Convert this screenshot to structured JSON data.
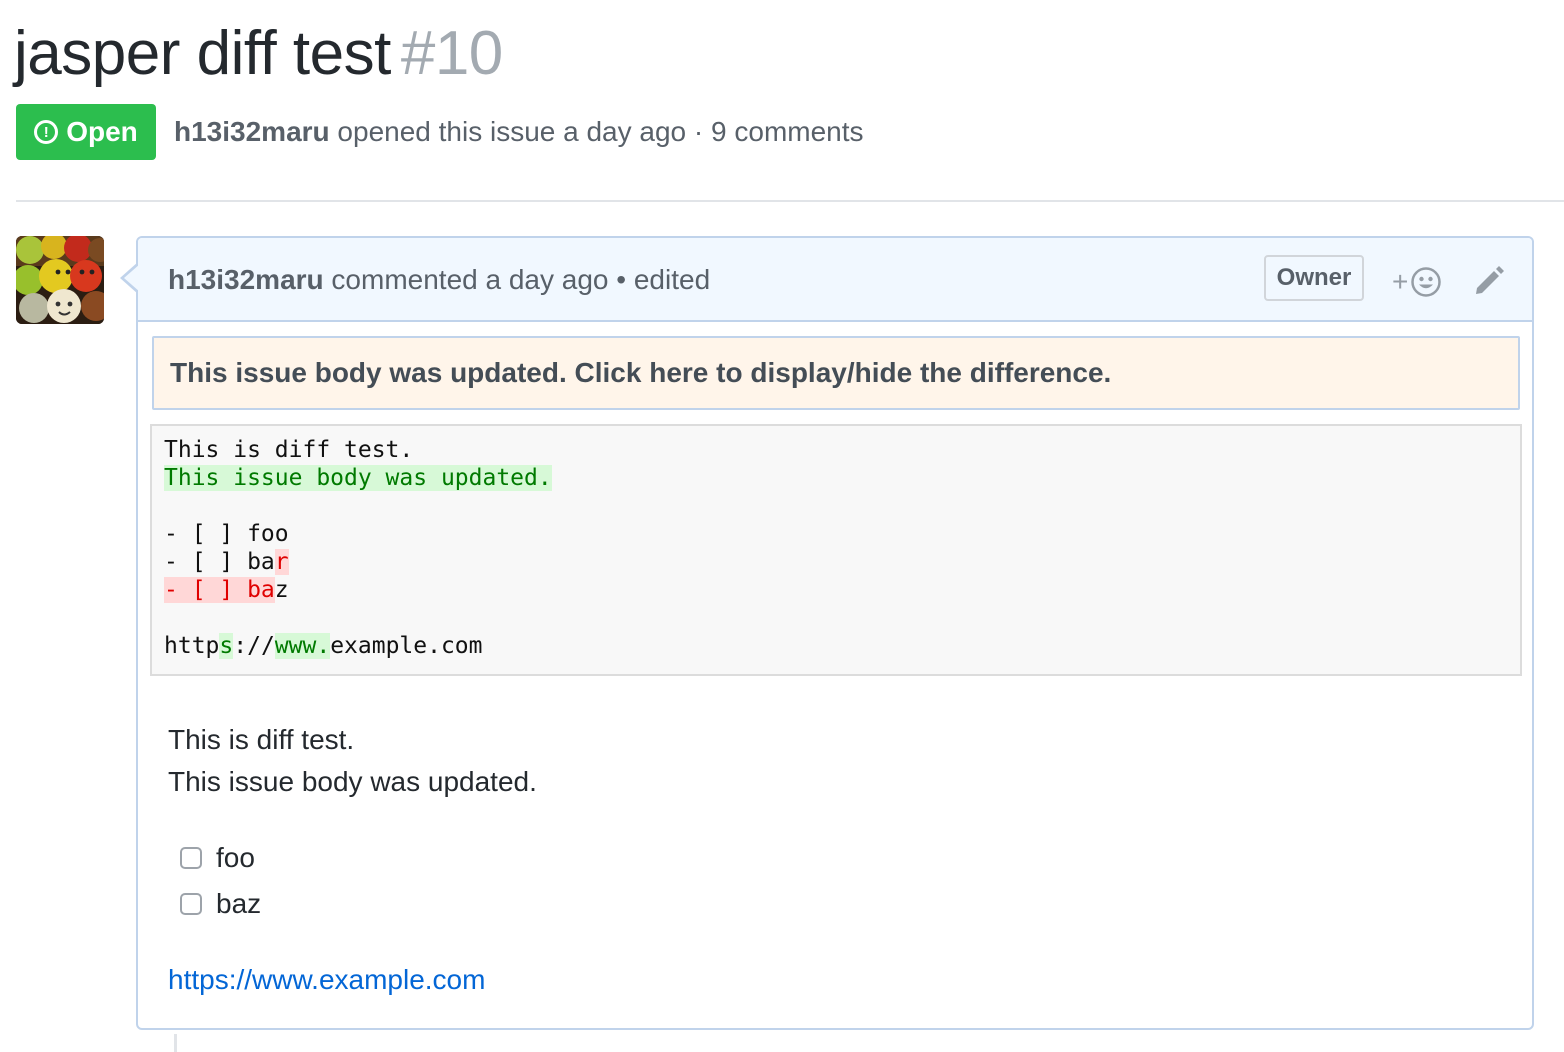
{
  "issue": {
    "title": "jasper diff test",
    "number": "#10"
  },
  "meta": {
    "state_label": "Open",
    "state_icon": "issue-opened-icon",
    "state_color": "#2cbe4e",
    "author": "h13i32maru",
    "opened_text": "opened this issue a day ago",
    "separator": "·",
    "comments": "9 comments"
  },
  "comment": {
    "author": "h13i32maru",
    "commented_text": "commented a day ago",
    "bullet": "•",
    "edited": "edited",
    "owner_label": "Owner",
    "reaction_plus": "+",
    "reaction_icon": "smiley-icon",
    "edit_icon": "pencil-icon",
    "header_bg": "#f1f8ff",
    "border_color": "#c0d3eb"
  },
  "diff_notice": {
    "text": "This issue body was updated. Click here to display/hide the difference.",
    "bg": "#fff5ea"
  },
  "diff": {
    "line1": "This is diff test.",
    "line2_added": "This issue body was updated.",
    "foo_line": "- [ ] foo",
    "bar_line_prefix": "- [ ] ba",
    "bar_line_added": "r",
    "baz_line_deleted": "- [ ] ba",
    "baz_line_suffix": "z",
    "url_1": "http",
    "url_2_added": "s",
    "url_3": "://",
    "url_4_added": "www.",
    "url_5": "example.com",
    "added_color": "#007a00",
    "deleted_color": "#e00000"
  },
  "body": {
    "line1": "This is diff test.",
    "line2": "This issue body was updated.",
    "tasks": [
      {
        "label": "foo",
        "checked": false
      },
      {
        "label": "baz",
        "checked": false
      }
    ],
    "link": "https://www.example.com",
    "link_color": "#0366d6"
  }
}
